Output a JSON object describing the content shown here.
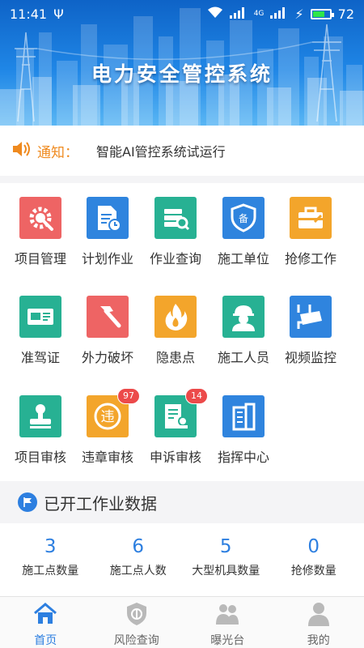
{
  "status_bar": {
    "time": "11:41",
    "battery": "72",
    "battery_level": 0.72,
    "network": "4G"
  },
  "app": {
    "title": "电力安全管控系统"
  },
  "notice": {
    "label": "通知：",
    "text": "智能AI管控系统试运行"
  },
  "grid": [
    {
      "label": "项目管理",
      "icon": "gear-wrench-icon",
      "color": "#ee6464",
      "badge": null
    },
    {
      "label": "计划作业",
      "icon": "document-clock-icon",
      "color": "#2f84de",
      "badge": null
    },
    {
      "label": "作业查询",
      "icon": "books-search-icon",
      "color": "#27b193",
      "badge": null
    },
    {
      "label": "施工单位",
      "icon": "shield-bei-icon",
      "color": "#2f84de",
      "badge": null
    },
    {
      "label": "抢修工作",
      "icon": "toolbox-icon",
      "color": "#f3a52b",
      "badge": null
    },
    {
      "label": "准驾证",
      "icon": "license-card-icon",
      "color": "#27b193",
      "badge": null
    },
    {
      "label": "外力破坏",
      "icon": "hammer-icon",
      "color": "#ee6464",
      "badge": null
    },
    {
      "label": "隐患点",
      "icon": "fire-icon",
      "color": "#f3a52b",
      "badge": null
    },
    {
      "label": "施工人员",
      "icon": "worker-helmet-icon",
      "color": "#27b193",
      "badge": null
    },
    {
      "label": "视频监控",
      "icon": "camera-icon",
      "color": "#2f84de",
      "badge": null
    },
    {
      "label": "项目审核",
      "icon": "stamp-icon",
      "color": "#27b193",
      "badge": null
    },
    {
      "label": "违章审核",
      "icon": "violation-icon",
      "color": "#f3a52b",
      "badge": "97"
    },
    {
      "label": "申诉审核",
      "icon": "appeal-doc-icon",
      "color": "#27b193",
      "badge": "14"
    },
    {
      "label": "指挥中心",
      "icon": "building-icon",
      "color": "#2f84de",
      "badge": null
    }
  ],
  "section": {
    "title": "已开工作业数据"
  },
  "stats": [
    {
      "value": "3",
      "label": "施工点数量"
    },
    {
      "value": "6",
      "label": "施工点人数"
    },
    {
      "value": "5",
      "label": "大型机具数量"
    },
    {
      "value": "0",
      "label": "抢修数量"
    }
  ],
  "tabs": [
    {
      "label": "首页",
      "icon": "home-icon",
      "active": true
    },
    {
      "label": "风险查询",
      "icon": "risk-shield-icon",
      "active": false
    },
    {
      "label": "曝光台",
      "icon": "people-icon",
      "active": false
    },
    {
      "label": "我的",
      "icon": "person-icon",
      "active": false
    }
  ],
  "colors": {
    "primary": "#2d7fe0",
    "notice": "#ef8a1f",
    "badge": "#ec4a4a"
  }
}
